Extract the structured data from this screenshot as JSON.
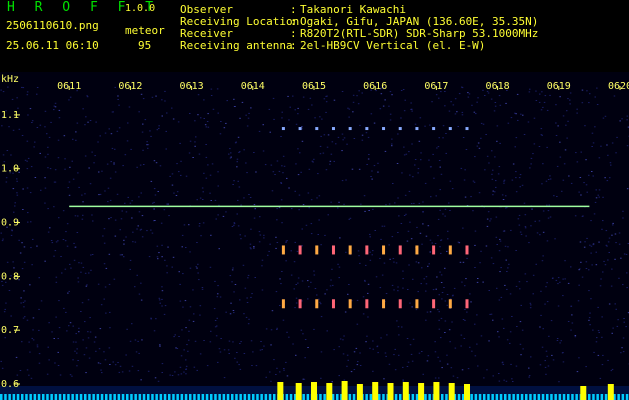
{
  "header": {
    "logo": "H R O F F T",
    "version": "1.0.0",
    "filename": "2506110610.png",
    "datetime": "25.06.11 06:10",
    "meteor_label": "meteor",
    "meteor_count": "95"
  },
  "info": [
    {
      "label": "Observer",
      "sep": ":",
      "value": "Takanori Kawachi"
    },
    {
      "label": "Receiving Location",
      "sep": ":",
      "value": "Ogaki, Gifu, JAPAN (136.60E, 35.35N)"
    },
    {
      "label": "Receiver",
      "sep": ":",
      "value": "R820T2(RTL-SDR) SDR-Sharp 53.1000MHz"
    },
    {
      "label": "Receiving antenna",
      "sep": ":",
      "value": "2el-HB9CV Vertical (el. E-W)"
    }
  ],
  "colors": {
    "text_green": "#00e000",
    "text_yellow": "#ffff33",
    "background": "#000010",
    "carrier": "#a0ffa0",
    "meteor_bar": "#ffff00",
    "noise_bar": "#00ccff"
  },
  "chart_data": {
    "type": "heatmap",
    "ylabel": "kHz",
    "x_ticks": [
      "0611",
      "0612",
      "0613",
      "0614",
      "0615",
      "0616",
      "0617",
      "0618",
      "0619",
      "0620"
    ],
    "x_range_minutes": [
      10,
      20
    ],
    "y_ticks": [
      "1.1",
      "1.0",
      "0.9",
      "0.8",
      "0.7",
      "0.6"
    ],
    "ylim_khz": [
      0.6,
      1.15
    ],
    "carrier_khz": 0.93,
    "tone_rows_khz": [
      1.07,
      0.85,
      0.75
    ],
    "tone_start_minute": 14.5,
    "tone_end_minute": 17.5,
    "tone_count": 12,
    "activity_bars": [
      {
        "minute": 14.45,
        "level": 0.9
      },
      {
        "minute": 14.75,
        "level": 0.85
      },
      {
        "minute": 15.0,
        "level": 0.9
      },
      {
        "minute": 15.25,
        "level": 0.85
      },
      {
        "minute": 15.5,
        "level": 0.95
      },
      {
        "minute": 15.75,
        "level": 0.8
      },
      {
        "minute": 16.0,
        "level": 0.9
      },
      {
        "minute": 16.25,
        "level": 0.85
      },
      {
        "minute": 16.5,
        "level": 0.9
      },
      {
        "minute": 16.75,
        "level": 0.85
      },
      {
        "minute": 17.0,
        "level": 0.9
      },
      {
        "minute": 17.25,
        "level": 0.85
      },
      {
        "minute": 17.5,
        "level": 0.8
      },
      {
        "minute": 19.4,
        "level": 0.7
      },
      {
        "minute": 19.85,
        "level": 0.8
      }
    ]
  }
}
